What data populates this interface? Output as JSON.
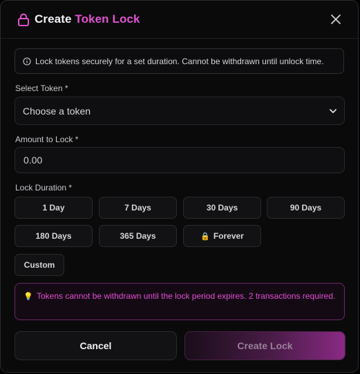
{
  "modal": {
    "title_prefix": "Create ",
    "title_highlight": "Token Lock",
    "info_text": "Lock tokens securely for a set duration. Cannot be withdrawn until unlock time."
  },
  "token_field": {
    "label": "Select Token *",
    "value": "Choose a token"
  },
  "amount_field": {
    "label": "Amount to Lock *",
    "placeholder": "0.00"
  },
  "duration": {
    "label": "Lock Duration *",
    "options": [
      "1 Day",
      "7 Days",
      "30 Days",
      "90 Days",
      "180 Days",
      "365 Days",
      "Forever",
      "Custom"
    ]
  },
  "warning": {
    "text": "Tokens cannot be withdrawn until the lock period expires. 2 transactions required."
  },
  "actions": {
    "cancel_label": "Cancel",
    "create_label": "Create Lock"
  },
  "icons": {
    "title": "lock-icon",
    "close": "close-icon",
    "info": "info-icon",
    "select": "chevron-down-icon",
    "forever": "padlock-emoji-icon",
    "warning": "lightbulb-icon"
  },
  "colors": {
    "accent": "#e251cf",
    "background": "#0a0a0b",
    "warning_border": "#6a2a64"
  }
}
